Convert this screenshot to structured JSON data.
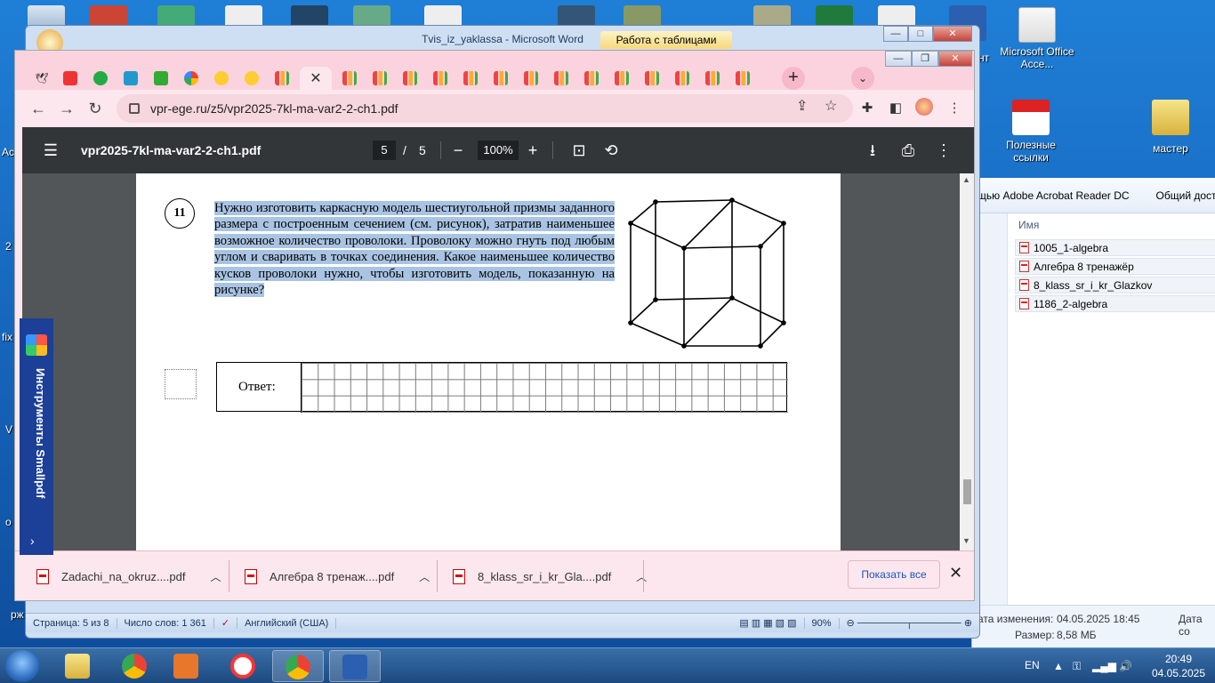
{
  "desktop": {
    "icons": [
      {
        "label": "Microsoft Office Acce...",
        "icon": "access-icon"
      }
    ],
    "left_fragments": [
      "Ac",
      "2",
      "fix",
      "V",
      "о",
      "рж"
    ],
    "right_fragments": [
      "нт",
      "Полезные",
      "ссылки",
      "мастер"
    ]
  },
  "explorer": {
    "toolbar_items": [
      "щью Adobe Acrobat Reader DC",
      "Общий дост"
    ],
    "column_header": "Имя",
    "files": [
      "1005_1-algebra",
      "Алгебра 8 тренажёр",
      "8_klass_sr_i_kr_Glazkov",
      "1186_2-algebra"
    ],
    "status": {
      "modified_label": "ата изменения:",
      "modified_value": "04.05.2025 18:45",
      "created_label": "Дата со",
      "size_label": "Размер:",
      "size_value": "8,58 МБ"
    }
  },
  "word": {
    "title": "Tvis_iz_yaklassa - Microsoft Word",
    "context_tab": "Работа с таблицами",
    "status": {
      "page": "Страница: 5 из 8",
      "words": "Число слов: 1 361",
      "language": "Английский (США)",
      "zoom": "90%"
    }
  },
  "chrome": {
    "url": "vpr-ege.ru/z5/vpr2025-7kl-ma-var2-2-ch1.pdf",
    "tabs_count_display": 25
  },
  "pdf": {
    "filename": "vpr2025-7kl-ma-var2-2-ch1.pdf",
    "page_current": "5",
    "page_separator": "/",
    "page_total": "5",
    "zoom": "100%",
    "question_number": "11",
    "question_text": "Нужно изготовить каркасную модель шестиугольной призмы заданного размера с построенным сечением (см. рисунок), затратив наименьшее возможное количество проволоки. Проволоку можно гнуть под любым углом и сваривать в точках соединения. Какое наименьшее количество кусков проволоки нужно, чтобы изготовить модель, показанную на рисунке?",
    "answer_label": "Ответ:"
  },
  "smallpdf": {
    "label": "Инструменты Smallpdf"
  },
  "downloads": {
    "items": [
      "Zadachi_na_okruz....pdf",
      "Алгебра 8 тренаж....pdf",
      "8_klass_sr_i_kr_Gla....pdf"
    ],
    "show_all": "Показать все"
  },
  "taskbar": {
    "lang": "EN",
    "time": "20:49",
    "date": "04.05.2025"
  }
}
